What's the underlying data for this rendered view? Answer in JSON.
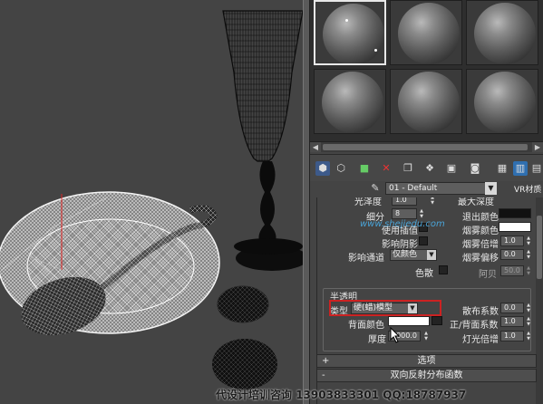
{
  "material": {
    "name": "01 - Default",
    "type_label": "VR材质"
  },
  "watermark": {
    "url": "www.shejiedu.com",
    "footer_prefix": "代设计培训咨询",
    "footer_phone": "13903833301",
    "footer_qq": "QQ:18787937"
  },
  "colors": {
    "panel": "#444444",
    "slot_bg": "#2e2e2e",
    "highlight_box": "#cc2222",
    "input_bg": "#5e5e5e"
  },
  "params_top": {
    "glossiness_label": "光泽度",
    "glossiness_value": "1.0",
    "max_depth_label": "最大深度",
    "subdivs_label": "细分",
    "subdivs_value": "8",
    "exit_color_label": "退出颜色",
    "use_interp_label": "使用插值",
    "fog_color_label": "烟雾颜色",
    "affect_shadows_label": "影响阴影",
    "fog_multiplier_label": "烟雾倍增",
    "fog_multiplier_value": "1.0",
    "affect_channels_label": "影响通道",
    "affect_channels_value": "仅颜色",
    "fog_bias_label": "烟雾偏移",
    "fog_bias_value": "0.0",
    "dispersion_label": "色散",
    "abbe_label": "阿贝",
    "abbe_value": "50.0"
  },
  "translucency": {
    "group_title": "半透明",
    "type_label": "类型",
    "type_value": "硬(蜡)模型",
    "scatter_coeff_label": "散布系数",
    "scatter_coeff_value": "0.0",
    "back_color_label": "背面颜色",
    "fwd_bck_coeff_label": "正/背面系数",
    "fwd_bck_coeff_value": "1.0",
    "thickness_label": "厚度",
    "thickness_value": "1000.0",
    "light_mult_label": "灯光倍增",
    "light_mult_value": "1.0"
  },
  "rollouts": {
    "options_label": "选项",
    "options_sign": "+",
    "brdf_label": "双向反射分布函数",
    "brdf_sign": "-"
  },
  "icons": [
    "sample-type-icon",
    "backlight-icon",
    "background-icon",
    "delete-icon",
    "copy-icon",
    "unique-icon",
    "put-to-library-icon",
    "material-id-icon",
    "show-map-icon",
    "show-result-icon",
    "go-to-parent-icon"
  ]
}
